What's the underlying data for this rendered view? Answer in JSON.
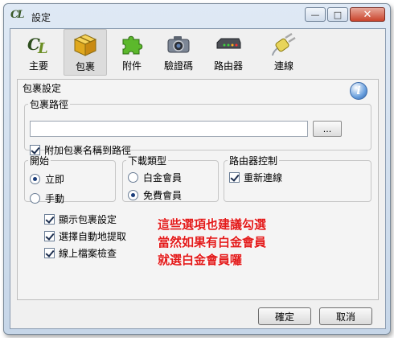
{
  "window": {
    "title": "設定",
    "app_logo": "CL"
  },
  "controls": {
    "minimize": "—",
    "maximize": "□",
    "close": "✕"
  },
  "toolbar": {
    "items": [
      {
        "label": "主要",
        "icon": "cl-logo-icon"
      },
      {
        "label": "包裹",
        "icon": "package-box-icon",
        "selected": true
      },
      {
        "label": "附件",
        "icon": "puzzle-piece-icon"
      },
      {
        "label": "驗證碼",
        "icon": "camera-icon"
      },
      {
        "label": "路由器",
        "icon": "router-icon"
      },
      {
        "label": "連線",
        "icon": "plug-icon"
      }
    ]
  },
  "panel": {
    "title": "包裹設定",
    "path_group": {
      "legend": "包裹路徑",
      "path_value": "",
      "browse_label": "...",
      "append_name_label": "附加包裹名稱到路徑",
      "append_name_checked": true
    },
    "start_group": {
      "legend": "開始",
      "options": [
        {
          "label": "立即",
          "checked": true
        },
        {
          "label": "手動",
          "checked": false
        }
      ]
    },
    "download_group": {
      "legend": "下載類型",
      "options": [
        {
          "label": "白金會員",
          "checked": false
        },
        {
          "label": "免費會員",
          "checked": true
        }
      ]
    },
    "router_group": {
      "legend": "路由器控制",
      "reconnect_label": "重新連線",
      "reconnect_checked": true
    },
    "checkboxes": [
      {
        "label": "顯示包裹設定",
        "checked": true
      },
      {
        "label": "選擇自動地提取",
        "checked": true
      },
      {
        "label": "線上檔案檢查",
        "checked": true
      }
    ]
  },
  "annotation": {
    "lines": [
      "這些選項也建議勾選",
      "當然如果有白金會員",
      "就選白金會員囉"
    ],
    "color": "#e31a1a"
  },
  "buttons": {
    "ok": "確定",
    "cancel": "取消"
  }
}
